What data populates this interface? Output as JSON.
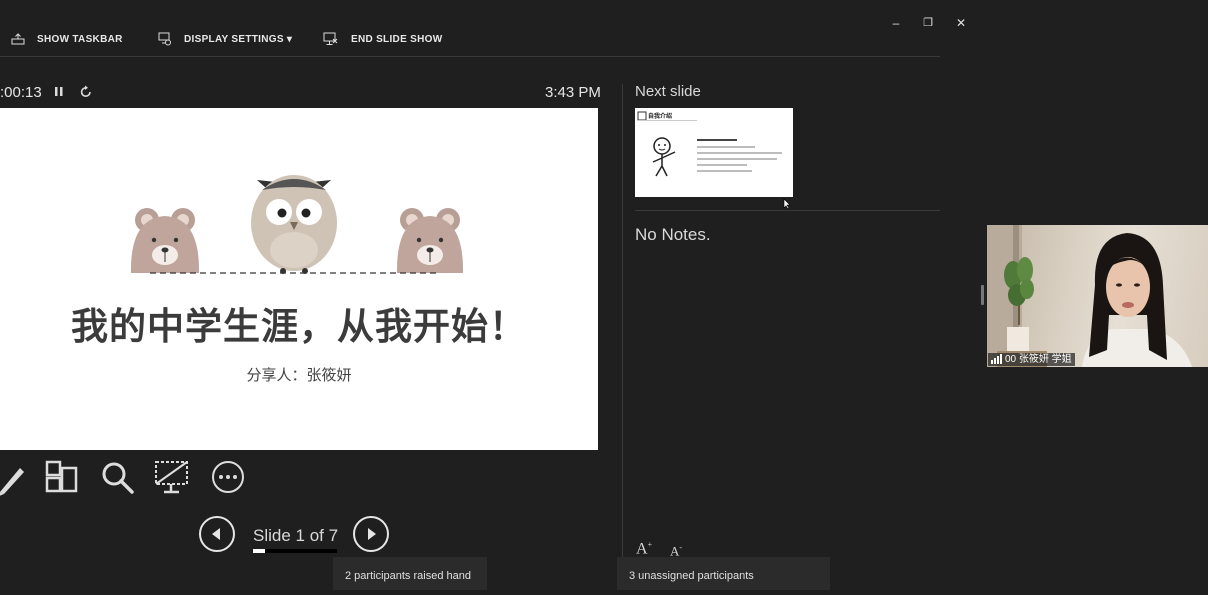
{
  "toolbar": {
    "show_taskbar": "SHOW TASKBAR",
    "display_settings": "DISPLAY SETTINGS ▾",
    "end_slide_show": "END SLIDE SHOW"
  },
  "window_controls": {
    "minimize": "–",
    "restore": "❐",
    "close": "✕"
  },
  "presenter": {
    "timer": ":00:13",
    "clock": "3:43 PM",
    "slide_title": "我的中学生涯，从我开始！",
    "slide_subtitle": "分享人：张筱妍",
    "slide_counter": "Slide 1 of 7",
    "progress_fraction": 0.14
  },
  "next_slide": {
    "label": "Next slide",
    "thumb_title": "自我介绍"
  },
  "notes": {
    "text": "No Notes."
  },
  "font_buttons": {
    "increase": "A",
    "decrease": "A"
  },
  "toasts": {
    "raised_hand": "2 participants raised hand",
    "unassigned": "3 unassigned participants"
  },
  "video": {
    "participant_name": "00 张筱妍 学姐"
  }
}
